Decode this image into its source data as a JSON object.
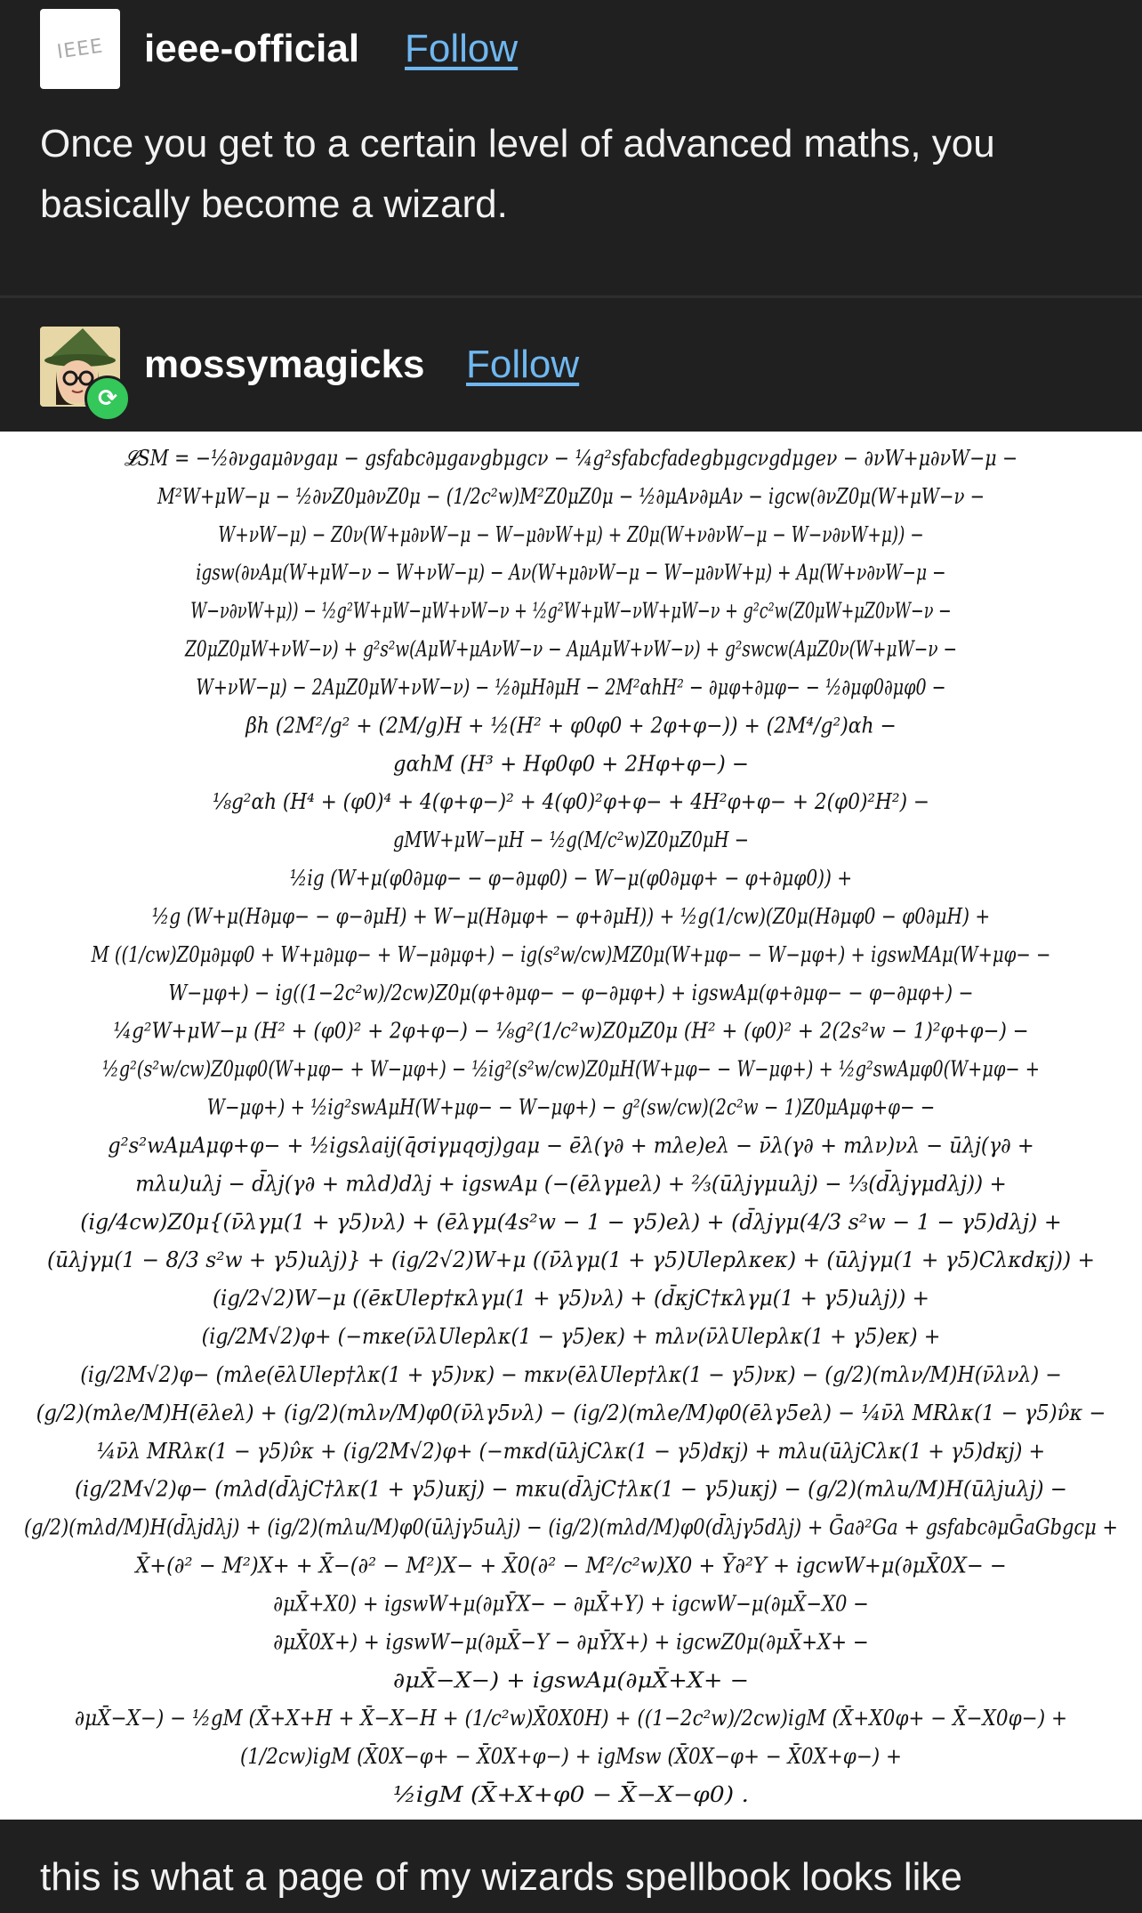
{
  "post": {
    "author": "ieee-official",
    "follow_label": "Follow",
    "avatar_text": "IEEE",
    "caption": "Once you get to a certain level of advanced maths, you basically become a wizard."
  },
  "reblog": {
    "author": "mossymagicks",
    "follow_label": "Follow",
    "caption": "this is what a page of my wizards spellbook looks like"
  },
  "equation": {
    "lines": [
      "𝓛SM = −½∂νgaμ∂νgaμ − gsfabc∂μgaνgbμgcν − ¼g²sfabcfadegbμgcνgdμgeν − ∂νW+μ∂νW−μ −",
      "M²W+μW−μ − ½∂νZ0μ∂νZ0μ − (1/2c²w)M²Z0μZ0μ − ½∂μAν∂μAν − igcw(∂νZ0μ(W+μW−ν −",
      "W+νW−μ) − Z0ν(W+μ∂νW−μ − W−μ∂νW+μ) + Z0μ(W+ν∂νW−μ − W−ν∂νW+μ)) −",
      "igsw(∂νAμ(W+μW−ν − W+νW−μ) − Aν(W+μ∂νW−μ − W−μ∂νW+μ) + Aμ(W+ν∂νW−μ −",
      "W−ν∂νW+μ)) − ½g²W+μW−μW+νW−ν + ½g²W+μW−νW+μW−ν + g²c²w(Z0μW+μZ0νW−ν −",
      "Z0μZ0μW+νW−ν) + g²s²w(AμW+μAνW−ν − AμAμW+νW−ν) + g²swcw(AμZ0ν(W+μW−ν −",
      "W+νW−μ) − 2AμZ0μW+νW−ν) − ½∂μH∂μH − 2M²αhH² − ∂μφ+∂μφ− − ½∂μφ0∂μφ0 −",
      "βh (2M²/g² + (2M/g)H + ½(H² + φ0φ0 + 2φ+φ−)) + (2M⁴/g²)αh −",
      "gαhM (H³ + Hφ0φ0 + 2Hφ+φ−) −",
      "⅛g²αh (H⁴ + (φ0)⁴ + 4(φ+φ−)² + 4(φ0)²φ+φ− + 4H²φ+φ− + 2(φ0)²H²) −",
      "gMW+μW−μH − ½g(M/c²w)Z0μZ0μH −",
      "½ig (W+μ(φ0∂μφ− − φ−∂μφ0) − W−μ(φ0∂μφ+ − φ+∂μφ0)) +",
      "½g (W+μ(H∂μφ− − φ−∂μH) + W−μ(H∂μφ+ − φ+∂μH)) + ½g(1/cw)(Z0μ(H∂μφ0 − φ0∂μH) +",
      "M ((1/cw)Z0μ∂μφ0 + W+μ∂μφ− + W−μ∂μφ+) − ig(s²w/cw)MZ0μ(W+μφ− − W−μφ+) + igswMAμ(W+μφ− −",
      "W−μφ+) − ig((1−2c²w)/2cw)Z0μ(φ+∂μφ− − φ−∂μφ+) + igswAμ(φ+∂μφ− − φ−∂μφ+) −",
      "¼g²W+μW−μ (H² + (φ0)² + 2φ+φ−) − ⅛g²(1/c²w)Z0μZ0μ (H² + (φ0)² + 2(2s²w − 1)²φ+φ−) −",
      "½g²(s²w/cw)Z0μφ0(W+μφ− + W−μφ+) − ½ig²(s²w/cw)Z0μH(W+μφ− − W−μφ+) + ½g²swAμφ0(W+μφ− +",
      "W−μφ+) + ½ig²swAμH(W+μφ− − W−μφ+) − g²(sw/cw)(2c²w − 1)Z0μAμφ+φ− −",
      "g²s²wAμAμφ+φ− + ½igsλaij(q̄σiγμqσj)gaμ − ēλ(γ∂ + mλe)eλ − ν̄λ(γ∂ + mλν)νλ − ūλj(γ∂ +",
      "mλu)uλj − d̄λj(γ∂ + mλd)dλj + igswAμ (−(ēλγμeλ) + ⅔(ūλjγμuλj) − ⅓(d̄λjγμdλj)) +",
      "(ig/4cw)Z0μ{(ν̄λγμ(1 + γ5)νλ) + (ēλγμ(4s²w − 1 − γ5)eλ) + (d̄λjγμ(4/3 s²w − 1 − γ5)dλj) +",
      "(ūλjγμ(1 − 8/3 s²w + γ5)uλj)} + (ig/2√2)W+μ ((ν̄λγμ(1 + γ5)Ulepλκeκ) + (ūλjγμ(1 + γ5)Cλκdκj)) +",
      "(ig/2√2)W−μ ((ēκUlep†κλγμ(1 + γ5)νλ) + (d̄κjC†κλγμ(1 + γ5)uλj)) +",
      "(ig/2M√2)φ+ (−mκe(ν̄λUlepλκ(1 − γ5)eκ) + mλν(ν̄λUlepλκ(1 + γ5)eκ) +",
      "(ig/2M√2)φ− (mλe(ēλUlep†λκ(1 + γ5)νκ) − mκν(ēλUlep†λκ(1 − γ5)νκ) − (g/2)(mλν/M)H(ν̄λνλ) −",
      "(g/2)(mλe/M)H(ēλeλ) + (ig/2)(mλν/M)φ0(ν̄λγ5νλ) − (ig/2)(mλe/M)φ0(ēλγ5eλ) − ¼ν̄λ MRλκ(1 − γ5)ν̂κ −",
      "¼ν̄λ MRλκ(1 − γ5)ν̂κ + (ig/2M√2)φ+ (−mκd(ūλjCλκ(1 − γ5)dκj) + mλu(ūλjCλκ(1 + γ5)dκj) +",
      "(ig/2M√2)φ− (mλd(d̄λjC†λκ(1 + γ5)uκj) − mκu(d̄λjC†λκ(1 − γ5)uκj) − (g/2)(mλu/M)H(ūλjuλj) −",
      "(g/2)(mλd/M)H(d̄λjdλj) + (ig/2)(mλu/M)φ0(ūλjγ5uλj) − (ig/2)(mλd/M)φ0(d̄λjγ5dλj) + Ḡa∂²Ga + gsfabc∂μḠaGbgcμ +",
      "X̄+(∂² − M²)X+ + X̄−(∂² − M²)X− + X̄0(∂² − M²/c²w)X0 + Ȳ∂²Y + igcwW+μ(∂μX̄0X− −",
      "∂μX̄+X0) + igswW+μ(∂μȲX− − ∂μX̄+Y) + igcwW−μ(∂μX̄−X0 −",
      "∂μX̄0X+) + igswW−μ(∂μX̄−Y − ∂μȲX+) + igcwZ0μ(∂μX̄+X+ −",
      "∂μX̄−X−) + igswAμ(∂μX̄+X+ −",
      "∂μX̄−X−) − ½gM (X̄+X+H + X̄−X−H + (1/c²w)X̄0X0H) + ((1−2c²w)/2cw)igM (X̄+X0φ+ − X̄−X0φ−) +",
      "(1/2cw)igM (X̄0X−φ+ − X̄0X+φ−) + igMsw (X̄0X−φ+ − X̄0X+φ−) +",
      "½igM (X̄+X+φ0 − X̄−X−φ0) ."
    ]
  }
}
